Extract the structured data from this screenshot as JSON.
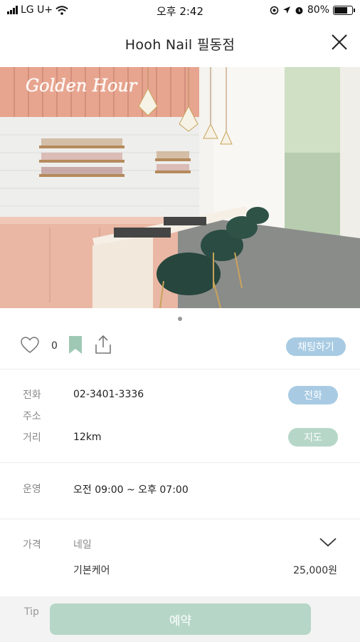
{
  "status_bar": {
    "carrier": "LG U+",
    "time": "오후 2:42",
    "battery": "80%",
    "battery_level": 0.8
  },
  "header": {
    "title": "Hooh Nail 필동점"
  },
  "hero": {
    "image_count": 1,
    "active_index": 0,
    "sign_text": "Golden Hour"
  },
  "actions": {
    "like_count": "0",
    "chat_label": "채팅하기"
  },
  "info": {
    "phone_label": "전화",
    "phone_value": "02-3401-3336",
    "phone_button": "전화",
    "address_label": "주소",
    "distance_label": "거리",
    "distance_value": "12km",
    "map_button": "지도",
    "hours_label": "운영",
    "hours_value": "오전 09:00 ~ 오후 07:00"
  },
  "price": {
    "label": "가격",
    "category": "네일",
    "items": [
      {
        "name": "기본케어",
        "price": "25,000원"
      }
    ]
  },
  "bottom": {
    "tip_label": "Tip",
    "reserve_label": "예약"
  },
  "colors": {
    "chat_button": "#a8cbe3",
    "map_button": "#b6d7c8",
    "reserve_button": "#b6d7c8",
    "bookmark": "#9fc8b4"
  }
}
